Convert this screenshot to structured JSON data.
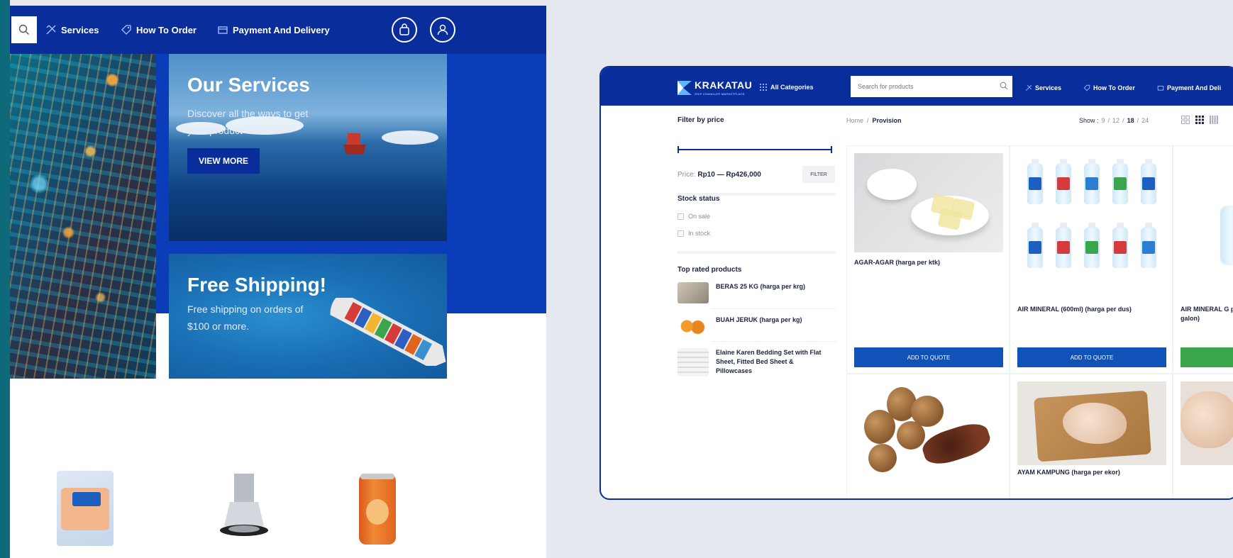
{
  "left_mockup": {
    "nav": {
      "services": "Services",
      "how_to_order": "How To Order",
      "payment_delivery": "Payment And Delivery"
    },
    "services_card": {
      "title": "Our Services",
      "text": "Discover all the ways to get your product",
      "button": "VIEW MORE"
    },
    "shipping_card": {
      "title": "Free Shipping!",
      "text": "Free shipping on orders of $100 or more."
    }
  },
  "shop": {
    "logo": {
      "name": "KRAKATAU",
      "tagline": "SHIP CHANDLER MARKETPLACE"
    },
    "all_categories": "All Categories",
    "search": {
      "placeholder": "Search for products"
    },
    "nav": {
      "services": "Services",
      "how_to_order": "How To Order",
      "payment_delivery": "Payment And Deli"
    },
    "sidebar": {
      "filter_title": "Filter by price",
      "price_label": "Price:",
      "price_range": "Rp10 — Rp426,000",
      "filter_button": "FILTER",
      "stock_title": "Stock status",
      "stock_options": [
        "On sale",
        "In stock"
      ],
      "top_rated_title": "Top rated products",
      "top_rated": [
        "BERAS 25 KG (harga per krg)",
        "BUAH JERUK (harga per kg)",
        "Elaine Karen Bedding Set with Flat Sheet, Fitted Bed Sheet & Pillowcases"
      ]
    },
    "breadcrumb": {
      "home": "Home",
      "sep": "/",
      "current": "Provision"
    },
    "show": {
      "label": "Show :",
      "options": [
        "9",
        "12",
        "18",
        "24"
      ],
      "active": "18"
    },
    "products": [
      {
        "name": "AGAR-AGAR (harga per ktk)",
        "button": "ADD TO QUOTE"
      },
      {
        "name": "AIR MINERAL (600ml) (harga per dus)",
        "button": "ADD TO QUOTE"
      },
      {
        "name": "AIR MINERAL G per galon)",
        "button": ""
      },
      {
        "name": "",
        "button": ""
      },
      {
        "name": "AYAM KAMPUNG (harga per ekor)",
        "button": ""
      },
      {
        "name": "",
        "button": ""
      }
    ]
  },
  "colors": {
    "primary": "#0a2d9c",
    "band": "#0b3db8",
    "button": "#1052b8",
    "green": "#3aa54a",
    "teal": "#0e6a7a",
    "background": "#e6e8f0"
  },
  "icons": [
    "search-icon",
    "tools-icon",
    "tag-icon",
    "box-icon",
    "bag-icon",
    "user-icon",
    "grid-icon"
  ]
}
